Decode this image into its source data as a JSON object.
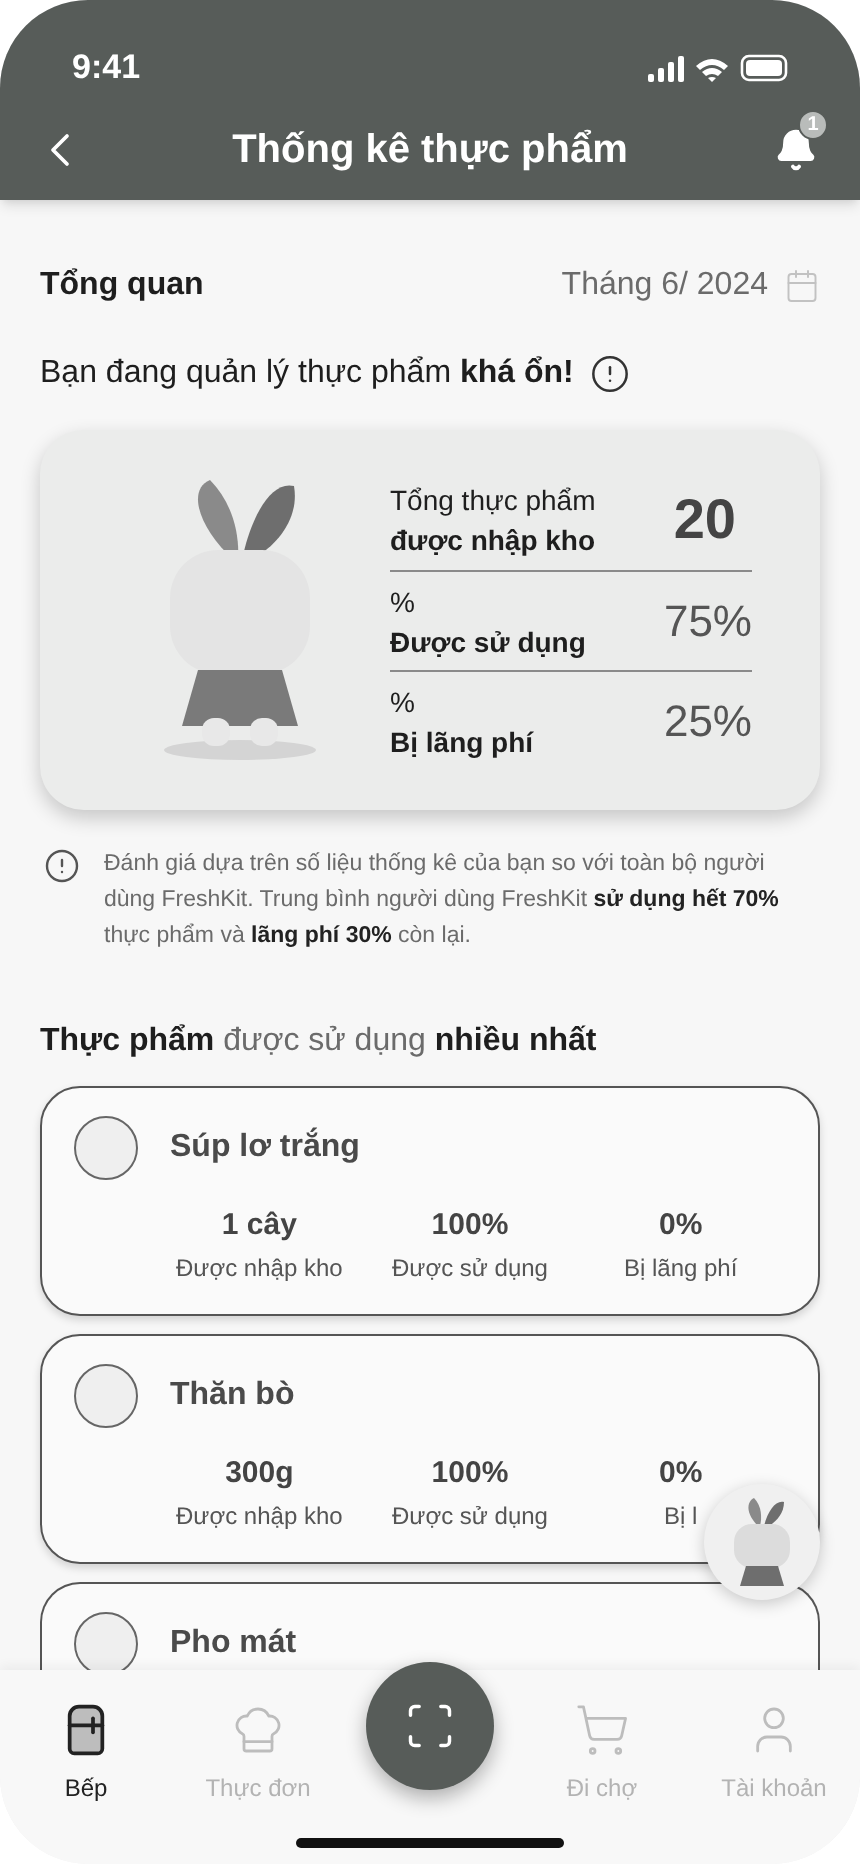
{
  "status_bar": {
    "time": "9:41"
  },
  "header": {
    "title": "Thống kê thực phẩm",
    "notification_count": "1"
  },
  "overview": {
    "title": "Tổng quan",
    "period": "Tháng 6/ 2024",
    "message": "Bạn đang quản lý thực phẩm **khá ổn!**"
  },
  "summary": [
    {
      "kind": "total",
      "label_top": "Tổng thực phẩm",
      "label_bottom": "được nhập kho",
      "value": "20"
    },
    {
      "kind": "percent",
      "label_top": "%",
      "label_bottom": "Được sử dụng",
      "value": "75%"
    },
    {
      "kind": "percent",
      "label_top": "%",
      "label_bottom": "Bị lãng phí",
      "value": "25%"
    }
  ],
  "note": "Đánh giá dựa trên số liệu thống kê của bạn so với toàn bộ người dùng FreshKit. Trung bình người dùng FreshKit **sử dụng hết 70%** thực phẩm và **lãng phí 30%** còn lại.",
  "section_title": "**Thực phẩm** được sử dụng **nhiều nhất**",
  "foods": [
    {
      "name": "Súp lơ trắng",
      "stats": [
        {
          "value": "1 cây",
          "label": "Được nhập kho"
        },
        {
          "value": "100%",
          "label": "Được sử dụng"
        },
        {
          "value": "0%",
          "label": "Bị lãng phí"
        }
      ]
    },
    {
      "name": "Thăn bò",
      "stats": [
        {
          "value": "300g",
          "label": "Được nhập kho"
        },
        {
          "value": "100%",
          "label": "Được sử dụng"
        },
        {
          "value": "0%",
          "label": "Bị l"
        }
      ]
    },
    {
      "name": "Pho mát"
    }
  ],
  "nav": [
    {
      "kind": "fridge",
      "label": "Bếp",
      "selected": true
    },
    {
      "kind": "chef",
      "label": "Thực đơn",
      "selected": false
    },
    {
      "kind": "scan"
    },
    {
      "kind": "cart",
      "label": "Đi chợ",
      "selected": false
    },
    {
      "kind": "user",
      "label": "Tài khoản",
      "selected": false
    }
  ]
}
